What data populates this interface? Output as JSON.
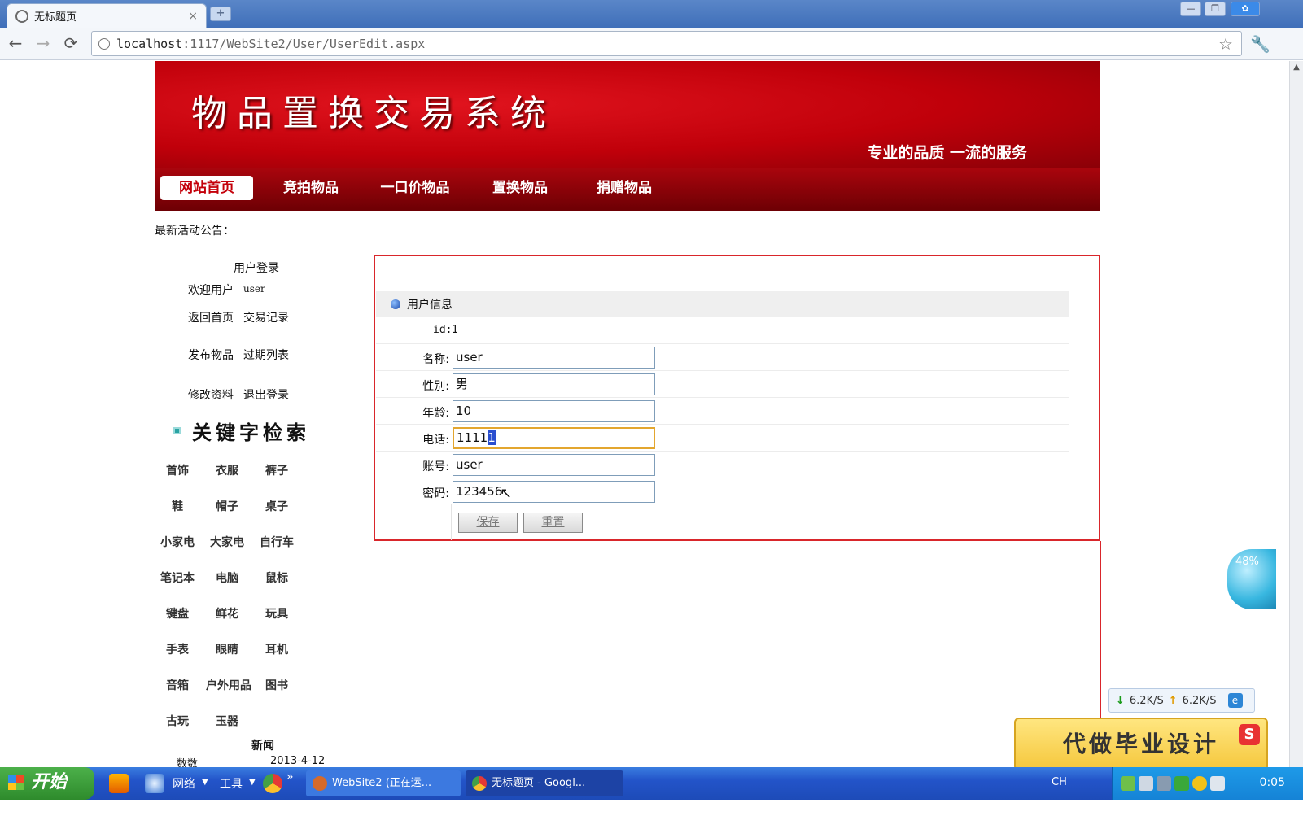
{
  "browser": {
    "tab_title": "无标题页",
    "tab_close": "×",
    "new_tab": "+",
    "url_host": "localhost",
    "url_rest": ":1117/WebSite2/User/UserEdit.aspx",
    "back_glyph": "←",
    "forward_glyph": "→",
    "reload_glyph": "⟳",
    "star_glyph": "☆",
    "wrench_glyph": "🔧"
  },
  "site": {
    "title": "物品置换交易系统",
    "slogan": "专业的品质  一流的服务",
    "menu": [
      "网站首页",
      "竞拍物品",
      "一口价物品",
      "置换物品",
      "捐赠物品"
    ],
    "notice": "最新活动公告："
  },
  "login_panel": {
    "title": "用户登录",
    "welcome": "欢迎用户",
    "username": "user",
    "links": [
      "返回首页",
      "交易记录",
      "发布物品",
      "过期列表",
      "修改资料",
      "退出登录"
    ]
  },
  "keyword_search": {
    "title": "关键字检索",
    "keywords": [
      "首饰",
      "衣服",
      "裤子",
      "鞋",
      "帽子",
      "桌子",
      "小家电",
      "大家电",
      "自行车",
      "笔记本",
      "电脑",
      "鼠标",
      "键盘",
      "鲜花",
      "玩具",
      "手表",
      "眼睛",
      "耳机",
      "音箱",
      "户外用品",
      "图书",
      "古玩",
      "玉器"
    ]
  },
  "news": {
    "title": "新闻",
    "items": [
      {
        "title": "数数",
        "date": "2013-4-12"
      }
    ]
  },
  "user_form": {
    "header": "用户信息",
    "id_label": "id:",
    "id_value": "1",
    "fields": [
      {
        "label": "名称:",
        "value": "user"
      },
      {
        "label": "性别:",
        "value": "男"
      },
      {
        "label": "年龄:",
        "value": "10"
      },
      {
        "label": "电话:",
        "value": "1111",
        "selected": "1"
      },
      {
        "label": "账号:",
        "value": "user"
      },
      {
        "label": "密码:",
        "value": "123456"
      }
    ],
    "save_button": "保存",
    "reset_button": "重置"
  },
  "widgets": {
    "float_percent": "48%",
    "download_speed": "6.2K/S",
    "upload_speed": "6.2K/S",
    "ad_text": "代做毕业设计",
    "sogou": "S"
  },
  "taskbar": {
    "start_label": "开始",
    "network": "网络",
    "tools": "工具",
    "more": "»",
    "tasks": [
      "WebSite2 (正在运...",
      "无标题页 - Googl..."
    ],
    "lang": "CH",
    "clock": "0:05"
  },
  "colors": {
    "banner_red": "#c0000a",
    "frame_red": "#d9262b",
    "taskbar_blue": "#2354c9"
  }
}
